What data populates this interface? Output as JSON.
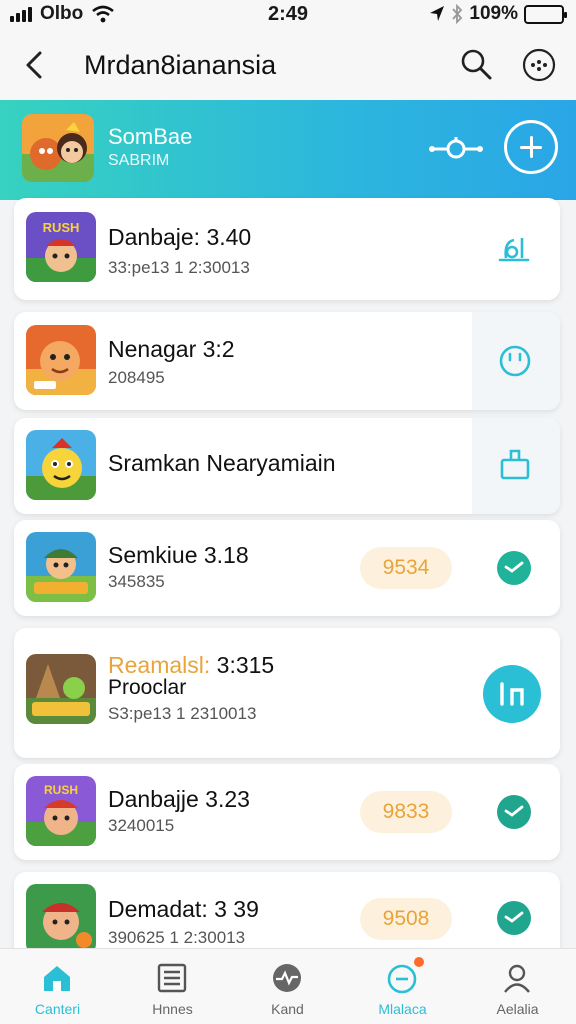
{
  "status": {
    "carrier": "Olbo",
    "time": "2:49",
    "battery": "109%"
  },
  "nav": {
    "title": "Mrdan8ianansia"
  },
  "banner": {
    "name": "SomBae",
    "subtitle": "SABRIM"
  },
  "cards": [
    {
      "name": "Danbaje: 3.40",
      "meta": "33:pe13   1   2:30013"
    },
    {
      "name": "Nenagar   3:2",
      "meta": "208495"
    },
    {
      "name": "Sramkan Nearyamiain"
    },
    {
      "name": "Semkiue 3.18",
      "meta": "345835",
      "score": "9534"
    },
    {
      "name_highlight": "Reamalsl: ",
      "name_rest": "3:315",
      "name2": "Prooclar",
      "meta": "S3:pe13   1   2310013"
    },
    {
      "name": "Danbajje 3.23",
      "meta": "3240015",
      "score": "9833"
    },
    {
      "name": "Demadat: 3 39",
      "meta": "390625   1   2:30013",
      "score": "9508"
    }
  ],
  "tabs": [
    {
      "label": "Canteri"
    },
    {
      "label": "Hnnes"
    },
    {
      "label": "Kand"
    },
    {
      "label": "Mlalaca"
    },
    {
      "label": "Aelalia"
    }
  ],
  "colors": {
    "accent": "#2bbfd6",
    "score": "#e8a43a",
    "teal_dark": "#20a68f"
  }
}
